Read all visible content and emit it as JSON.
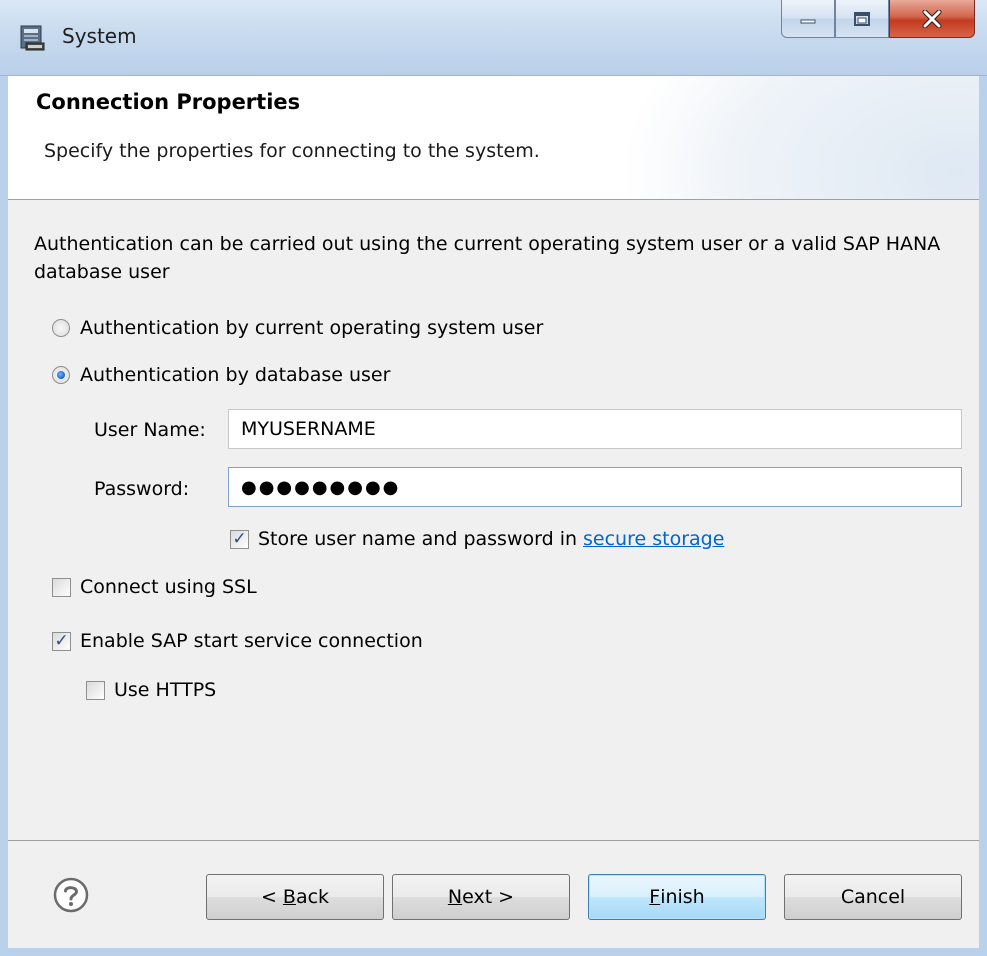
{
  "window": {
    "title": "System",
    "minimize_icon": "minimize-icon",
    "maximize_icon": "maximize-icon",
    "close_icon": "close-icon"
  },
  "header": {
    "title": "Connection Properties",
    "description": "Specify the properties for connecting to the system."
  },
  "content": {
    "intro": "Authentication can be carried out using the current operating system user or a valid SAP HANA database user",
    "auth_options": [
      {
        "label": "Authentication by current operating system user",
        "selected": false
      },
      {
        "label": "Authentication by database user",
        "selected": true
      }
    ],
    "user_name": {
      "label": "User Name:",
      "value": "MYUSERNAME"
    },
    "password": {
      "label": "Password:",
      "value": "●●●●●●●●●"
    },
    "store_credentials": {
      "label": "Store user name and password in",
      "link": "secure storage",
      "checked": true
    },
    "connect_ssl": {
      "label": "Connect using SSL",
      "checked": false
    },
    "enable_sap_start": {
      "label": "Enable SAP start service connection",
      "checked": true
    },
    "use_https": {
      "label": "Use HTTPS",
      "checked": false
    }
  },
  "footer": {
    "help_icon": "help-icon",
    "back_prefix": "< ",
    "back_mnemonic": "B",
    "back_rest": "ack",
    "next_mnemonic": "N",
    "next_rest": "ext >",
    "finish_mnemonic": "F",
    "finish_rest": "inish",
    "cancel": "Cancel"
  },
  "colors": {
    "accent": "#3c7fb1",
    "link": "#0066cc",
    "close_button": "#c23b1f"
  }
}
